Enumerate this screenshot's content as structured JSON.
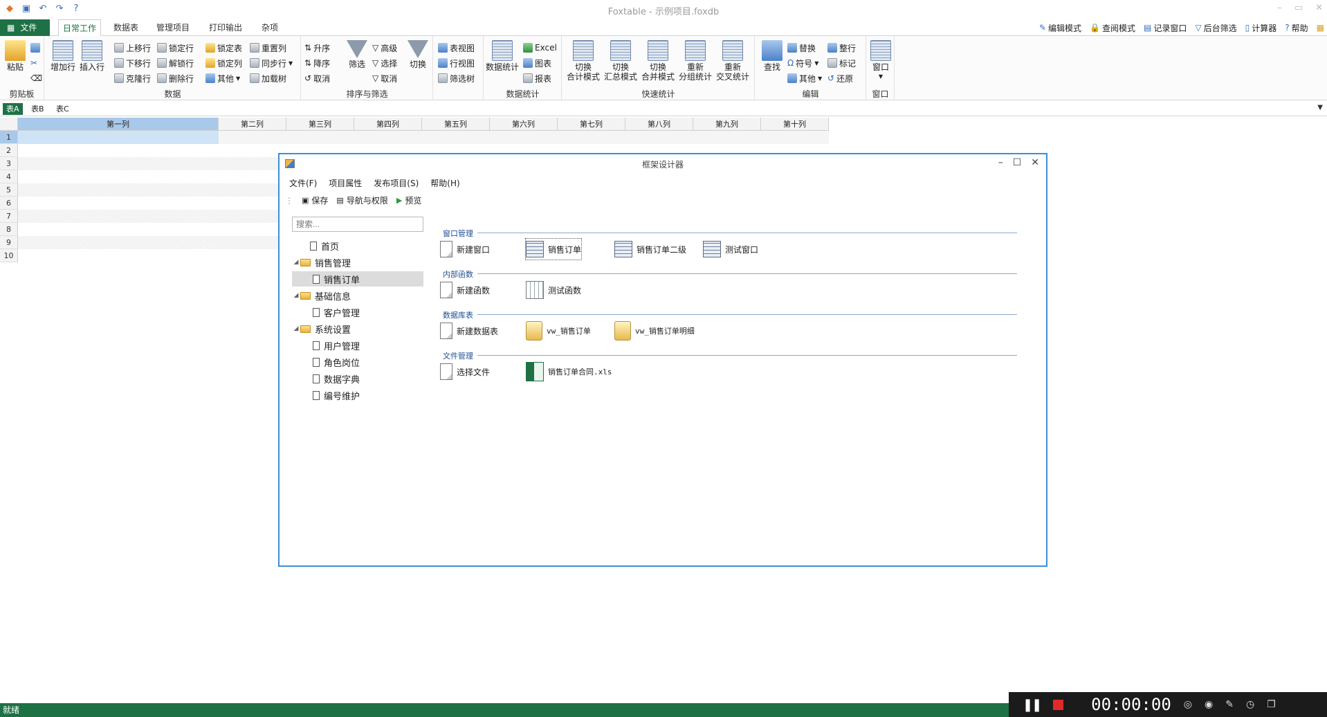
{
  "window": {
    "title": "Foxtable - 示例项目.foxdb"
  },
  "ribbon_tabs": {
    "file": "文件",
    "tabs": [
      "日常工作",
      "数据表",
      "管理项目",
      "打印输出",
      "杂项"
    ],
    "right_items": [
      "编辑模式",
      "查阅模式",
      "记录窗口",
      "后台筛选",
      "计算器",
      "帮助"
    ]
  },
  "ribbon": {
    "clipboard": {
      "label": "剪贴板",
      "paste": "粘贴"
    },
    "data": {
      "label": "数据",
      "add_row": "增加行",
      "insert_row": "插入行",
      "move_up": "上移行",
      "move_down": "下移行",
      "clone_row": "克隆行",
      "lock_row": "锁定行",
      "unlock_row": "解锁行",
      "delete_row": "删除行",
      "lock_table": "锁定表",
      "lock_col": "锁定列",
      "other": "其他",
      "reset_col": "重置列",
      "sync_row": "同步行",
      "load_tree": "加载树"
    },
    "sort_filter": {
      "label": "排序与筛选",
      "asc": "升序",
      "desc": "降序",
      "cancel": "取消",
      "filter": "筛选",
      "advanced": "高级",
      "select": "选择",
      "cancel2": "取消",
      "switch": "切换"
    },
    "views": {
      "table_view": "表视图",
      "row_view": "行视图",
      "filter_tree": "筛选树"
    },
    "data_stats": {
      "label": "数据统计",
      "stats": "数据统计",
      "excel": "Excel",
      "chart": "图表",
      "report": "报表"
    },
    "quick_stats": {
      "label": "快速统计",
      "btns": [
        "切换\n合计模式",
        "切换\n汇总模式",
        "切换\n合并模式",
        "重新\n分组统计",
        "重新\n交叉统计"
      ]
    },
    "edit": {
      "label": "编辑",
      "find": "查找",
      "replace": "替换",
      "symbol": "符号",
      "other": "其他",
      "whole_row": "整行",
      "mark": "标记",
      "restore": "还原"
    },
    "window": {
      "label": "窗口",
      "btn": "窗口"
    }
  },
  "sheet_tabs": [
    "表A",
    "表B",
    "表C"
  ],
  "grid": {
    "columns": [
      "第一列",
      "第二列",
      "第三列",
      "第四列",
      "第五列",
      "第六列",
      "第七列",
      "第八列",
      "第九列",
      "第十列"
    ],
    "rows": [
      "1",
      "2",
      "3",
      "4",
      "5",
      "6",
      "7",
      "8",
      "9",
      "10"
    ]
  },
  "dialog": {
    "title": "框架设计器",
    "menu": [
      "文件(F)",
      "项目属性",
      "发布项目(S)",
      "帮助(H)"
    ],
    "toolbar": {
      "save": "保存",
      "nav": "导航与权限",
      "preview": "预览"
    },
    "search_placeholder": "搜索...",
    "tree": [
      {
        "label": "首页",
        "level": 0,
        "type": "page",
        "expander": ""
      },
      {
        "label": "销售管理",
        "level": 0,
        "type": "folder",
        "expander": "◢"
      },
      {
        "label": "销售订单",
        "level": 1,
        "type": "page",
        "expander": "",
        "selected": true
      },
      {
        "label": "基础信息",
        "level": 0,
        "type": "folder",
        "expander": "◢"
      },
      {
        "label": "客户管理",
        "level": 1,
        "type": "page",
        "expander": ""
      },
      {
        "label": "系统设置",
        "level": 0,
        "type": "folder",
        "expander": "◢"
      },
      {
        "label": "用户管理",
        "level": 1,
        "type": "page",
        "expander": ""
      },
      {
        "label": "角色岗位",
        "level": 1,
        "type": "page",
        "expander": ""
      },
      {
        "label": "数据字典",
        "level": 1,
        "type": "page",
        "expander": ""
      },
      {
        "label": "编号维护",
        "level": 1,
        "type": "page",
        "expander": ""
      }
    ],
    "sections": [
      {
        "title": "窗口管理",
        "items": [
          {
            "label": "新建窗口",
            "icon": "page"
          },
          {
            "label": "销售订单",
            "icon": "form",
            "focused": true
          },
          {
            "label": "销售订单二级",
            "icon": "form"
          },
          {
            "label": "测试窗口",
            "icon": "form"
          }
        ]
      },
      {
        "title": "内部函数",
        "items": [
          {
            "label": "新建函数",
            "icon": "page"
          },
          {
            "label": "测试函数",
            "icon": "function"
          }
        ]
      },
      {
        "title": "数据库表",
        "items": [
          {
            "label": "新建数据表",
            "icon": "page"
          },
          {
            "label": "vw_销售订单",
            "icon": "database"
          },
          {
            "label": "vw_销售订单明细",
            "icon": "database"
          }
        ]
      },
      {
        "title": "文件管理",
        "items": [
          {
            "label": "选择文件",
            "icon": "page"
          },
          {
            "label": "销售订单合同.xls",
            "icon": "excel"
          }
        ]
      }
    ]
  },
  "status": {
    "text": "就绪"
  },
  "recorder": {
    "time": "00:00:00"
  },
  "colors": {
    "accent": "#1e7145",
    "dialog_border": "#3a8fd6",
    "selection": "#a8c9ea"
  }
}
